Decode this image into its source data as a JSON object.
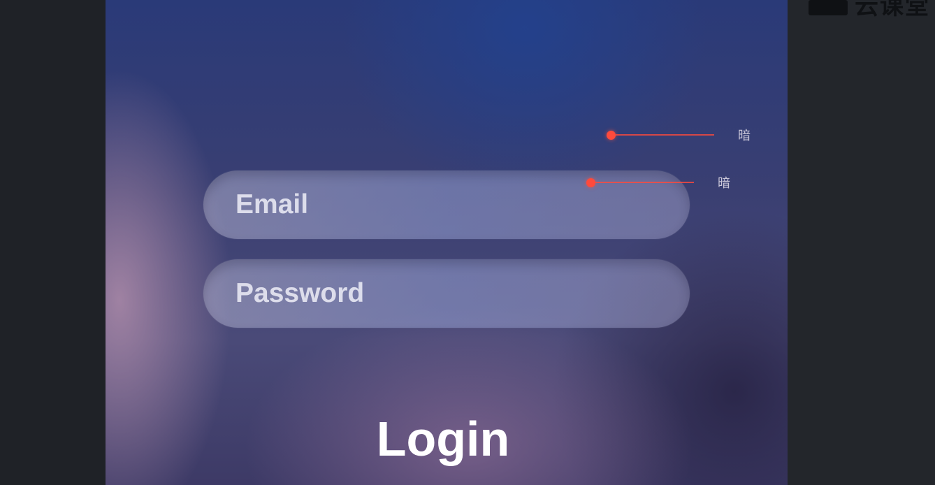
{
  "brand": {
    "text": "云课堂",
    "icon": "chat-icon"
  },
  "form": {
    "email_placeholder": "Email",
    "password_placeholder": "Password",
    "login_label": "Login"
  },
  "annotations": [
    {
      "text": "暗",
      "color": "#ff4a3c"
    },
    {
      "text": "暗",
      "color": "#ff4a3c"
    }
  ]
}
